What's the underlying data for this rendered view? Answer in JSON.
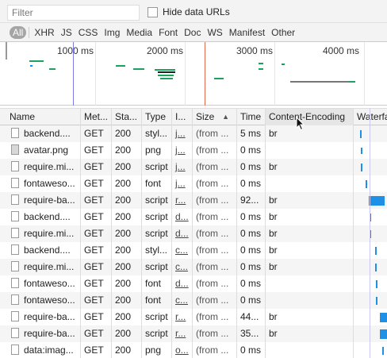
{
  "filter": {
    "placeholder": "Filter",
    "hide_data_label": "Hide data URLs"
  },
  "type_filters": [
    "All",
    "XHR",
    "JS",
    "CSS",
    "Img",
    "Media",
    "Font",
    "Doc",
    "WS",
    "Manifest",
    "Other"
  ],
  "overview": {
    "ticks": [
      "1000 ms",
      "2000 ms",
      "3000 ms",
      "4000 ms"
    ]
  },
  "columns": {
    "name": "Name",
    "method": "Met...",
    "status": "Sta...",
    "type": "Type",
    "initiator": "I...",
    "size": "Size",
    "time": "Time",
    "encoding": "Content-Encoding",
    "waterfall": "Waterfa"
  },
  "colors": {
    "waterfall_blue": "#1e90e6",
    "overview_green": "#1aa35b",
    "dom_line": "#7b7be8",
    "load_line": "#e06a50"
  },
  "rows": [
    {
      "name": "backend....",
      "icon": "file",
      "method": "GET",
      "status": "200",
      "type": "styl...",
      "initiator": "j...",
      "size": "(from ...",
      "time": "5 ms",
      "encoding": "br"
    },
    {
      "name": "avatar.png",
      "icon": "image",
      "method": "GET",
      "status": "200",
      "type": "png",
      "initiator": "j...",
      "size": "(from ...",
      "time": "0 ms",
      "encoding": ""
    },
    {
      "name": "require.mi...",
      "icon": "file",
      "method": "GET",
      "status": "200",
      "type": "script",
      "initiator": "j...",
      "size": "(from ...",
      "time": "0 ms",
      "encoding": "br"
    },
    {
      "name": "fontaweso...",
      "icon": "file",
      "method": "GET",
      "status": "200",
      "type": "font",
      "initiator": "j...",
      "size": "(from ...",
      "time": "0 ms",
      "encoding": ""
    },
    {
      "name": "require-ba...",
      "icon": "file",
      "method": "GET",
      "status": "200",
      "type": "script",
      "initiator": "r...",
      "size": "(from ...",
      "time": "92...",
      "encoding": "br"
    },
    {
      "name": "backend....",
      "icon": "file",
      "method": "GET",
      "status": "200",
      "type": "script",
      "initiator": "d...",
      "size": "(from ...",
      "time": "0 ms",
      "encoding": "br"
    },
    {
      "name": "require.mi...",
      "icon": "file",
      "method": "GET",
      "status": "200",
      "type": "script",
      "initiator": "d...",
      "size": "(from ...",
      "time": "0 ms",
      "encoding": "br"
    },
    {
      "name": "backend....",
      "icon": "file",
      "method": "GET",
      "status": "200",
      "type": "styl...",
      "initiator": "c...",
      "size": "(from ...",
      "time": "0 ms",
      "encoding": "br"
    },
    {
      "name": "require.mi...",
      "icon": "file",
      "method": "GET",
      "status": "200",
      "type": "script",
      "initiator": "c...",
      "size": "(from ...",
      "time": "0 ms",
      "encoding": "br"
    },
    {
      "name": "fontaweso...",
      "icon": "file",
      "method": "GET",
      "status": "200",
      "type": "font",
      "initiator": "d...",
      "size": "(from ...",
      "time": "0 ms",
      "encoding": ""
    },
    {
      "name": "fontaweso...",
      "icon": "file",
      "method": "GET",
      "status": "200",
      "type": "font",
      "initiator": "c...",
      "size": "(from ...",
      "time": "0 ms",
      "encoding": ""
    },
    {
      "name": "require-ba...",
      "icon": "file",
      "method": "GET",
      "status": "200",
      "type": "script",
      "initiator": "r...",
      "size": "(from ...",
      "time": "44...",
      "encoding": "br"
    },
    {
      "name": "require-ba...",
      "icon": "file",
      "method": "GET",
      "status": "200",
      "type": "script",
      "initiator": "r...",
      "size": "(from ...",
      "time": "35...",
      "encoding": "br"
    },
    {
      "name": "data:imag...",
      "icon": "file",
      "method": "GET",
      "status": "200",
      "type": "png",
      "initiator": "o...",
      "size": "(from ...",
      "time": "0 ms",
      "encoding": ""
    }
  ]
}
